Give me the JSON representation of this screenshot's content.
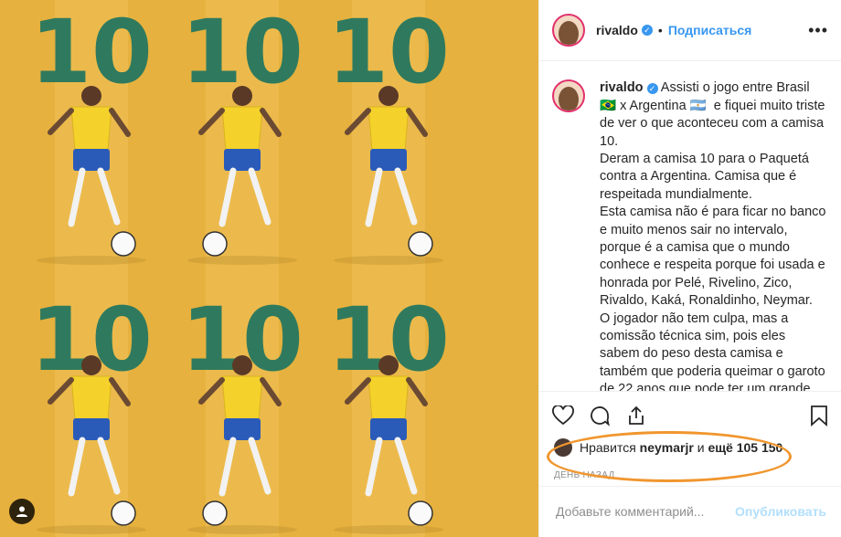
{
  "header": {
    "username": "rivaldo",
    "follow_label": "Подписаться",
    "more_label": "•••"
  },
  "caption": {
    "username": "rivaldo",
    "text": "Assisti o jogo entre Brasil 🇧🇷 x Argentina 🇦🇷  e fiquei muito triste de ver o que aconteceu com a camisa 10.\nDeram a camisa 10 para o Paquetá contra a Argentina. Camisa que é respeitada mundialmente.\nEsta camisa não é para ficar no banco e muito menos sair no intervalo, porque é a camisa que o mundo conhece e respeita porque foi usada e honrada por Pelé, Rivelino, Zico, Rivaldo, Kaká, Ronaldinho, Neymar.\nO jogador não tem culpa, mas a comissão técnica sim, pois eles sabem do peso desta camisa e também que poderia queimar o garoto de 22 anos que pode ter um grande futuro com a seleção brasileira.\nDa mesma forma que o treinador quis"
  },
  "media": {
    "jersey_number": "10",
    "colors": {
      "bg": "#e6b13e",
      "number": "#2f7a5e",
      "shirt": "#f4d22b",
      "shorts": "#2a5bb8"
    }
  },
  "likes": {
    "prefix": "Нравится",
    "user": "neymarjr",
    "conj": "и",
    "rest": "ещё 105 150"
  },
  "timestamp": "ДЕНЬ НАЗАД",
  "comment": {
    "placeholder": "Добавьте комментарий...",
    "post_label": "Опубликовать"
  }
}
